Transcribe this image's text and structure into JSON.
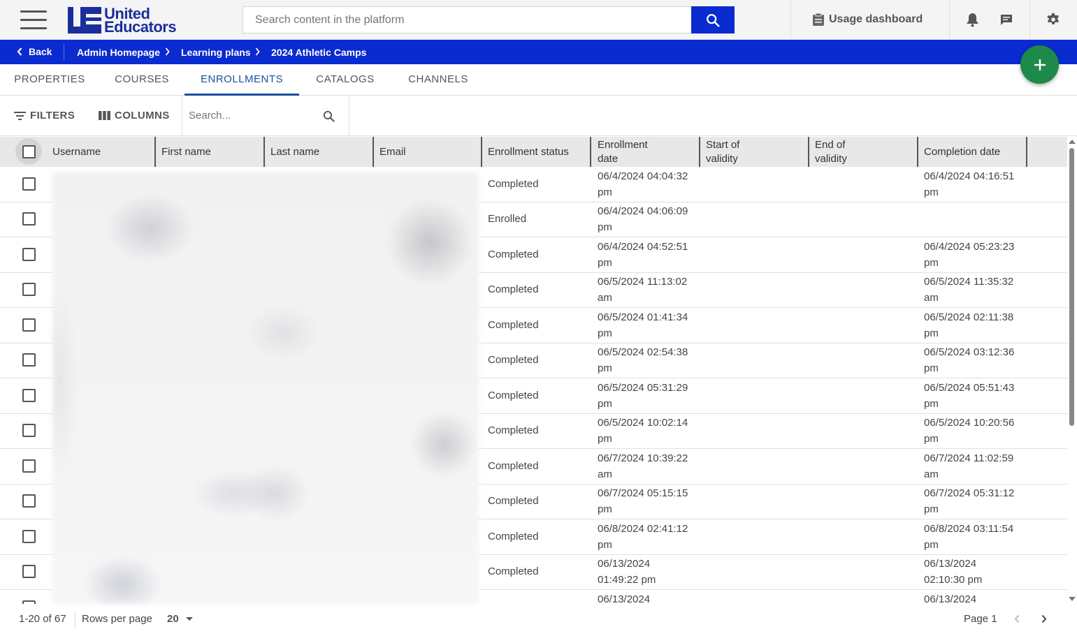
{
  "header": {
    "logo_line1": "United",
    "logo_line2": "Educators",
    "search_placeholder": "Search content in the platform",
    "usage_dashboard": "Usage dashboard"
  },
  "breadcrumb": {
    "back": "Back",
    "items": [
      "Admin Homepage",
      "Learning plans",
      "2024 Athletic Camps"
    ]
  },
  "tabs": [
    "PROPERTIES",
    "COURSES",
    "ENROLLMENTS",
    "CATALOGS",
    "CHANNELS"
  ],
  "active_tab": "ENROLLMENTS",
  "toolbar": {
    "filters": "FILTERS",
    "columns": "COLUMNS",
    "search_placeholder": "Search..."
  },
  "table": {
    "columns": {
      "username": "Username",
      "first_name": "First name",
      "last_name": "Last name",
      "email": "Email",
      "status": "Enrollment status",
      "enroll_l1": "Enrollment",
      "enroll_l2": "date",
      "start_l1": "Start of",
      "start_l2": "validity",
      "end_l1": "End of",
      "end_l2": "validity",
      "completion": "Completion date"
    },
    "rows": [
      {
        "status": "Completed",
        "enroll_a": "06/4/2024 04:04:32",
        "enroll_b": "pm",
        "comp_a": "06/4/2024 04:16:51",
        "comp_b": "pm"
      },
      {
        "status": "Enrolled",
        "enroll_a": "06/4/2024 04:06:09",
        "enroll_b": "pm",
        "comp_a": "",
        "comp_b": ""
      },
      {
        "status": "Completed",
        "enroll_a": "06/4/2024 04:52:51",
        "enroll_b": "pm",
        "comp_a": "06/4/2024 05:23:23",
        "comp_b": "pm"
      },
      {
        "status": "Completed",
        "enroll_a": "06/5/2024 11:13:02",
        "enroll_b": "am",
        "comp_a": "06/5/2024 11:35:32",
        "comp_b": "am"
      },
      {
        "status": "Completed",
        "enroll_a": "06/5/2024 01:41:34",
        "enroll_b": "pm",
        "comp_a": "06/5/2024 02:11:38",
        "comp_b": "pm"
      },
      {
        "status": "Completed",
        "enroll_a": "06/5/2024 02:54:38",
        "enroll_b": "pm",
        "comp_a": "06/5/2024 03:12:36",
        "comp_b": "pm"
      },
      {
        "status": "Completed",
        "enroll_a": "06/5/2024 05:31:29",
        "enroll_b": "pm",
        "comp_a": "06/5/2024 05:51:43",
        "comp_b": "pm"
      },
      {
        "status": "Completed",
        "enroll_a": "06/5/2024 10:02:14",
        "enroll_b": "pm",
        "comp_a": "06/5/2024 10:20:56",
        "comp_b": "pm"
      },
      {
        "status": "Completed",
        "enroll_a": "06/7/2024 10:39:22",
        "enroll_b": "am",
        "comp_a": "06/7/2024 11:02:59",
        "comp_b": "am"
      },
      {
        "status": "Completed",
        "enroll_a": "06/7/2024 05:15:15",
        "enroll_b": "pm",
        "comp_a": "06/7/2024 05:31:12",
        "comp_b": "pm"
      },
      {
        "status": "Completed",
        "enroll_a": "06/8/2024 02:41:12",
        "enroll_b": "pm",
        "comp_a": "06/8/2024 03:11:54",
        "comp_b": "pm"
      },
      {
        "status": "Completed",
        "enroll_a": "06/13/2024",
        "enroll_b": "01:49:22 pm",
        "comp_a": "06/13/2024",
        "comp_b": "02:10:30 pm"
      },
      {
        "status": "",
        "enroll_a": "06/13/2024",
        "enroll_b": "",
        "comp_a": "06/13/2024",
        "comp_b": ""
      }
    ]
  },
  "footer": {
    "range": "1-20 of 67",
    "rows_per_page_label": "Rows per page",
    "rows_per_page_value": "20",
    "page_label": "Page 1"
  },
  "colors": {
    "brand_blue": "#0a2bcf",
    "logo_blue": "#1a2e9c",
    "active_tab": "#1a4fa0",
    "fab_green": "#1d8a4a"
  }
}
